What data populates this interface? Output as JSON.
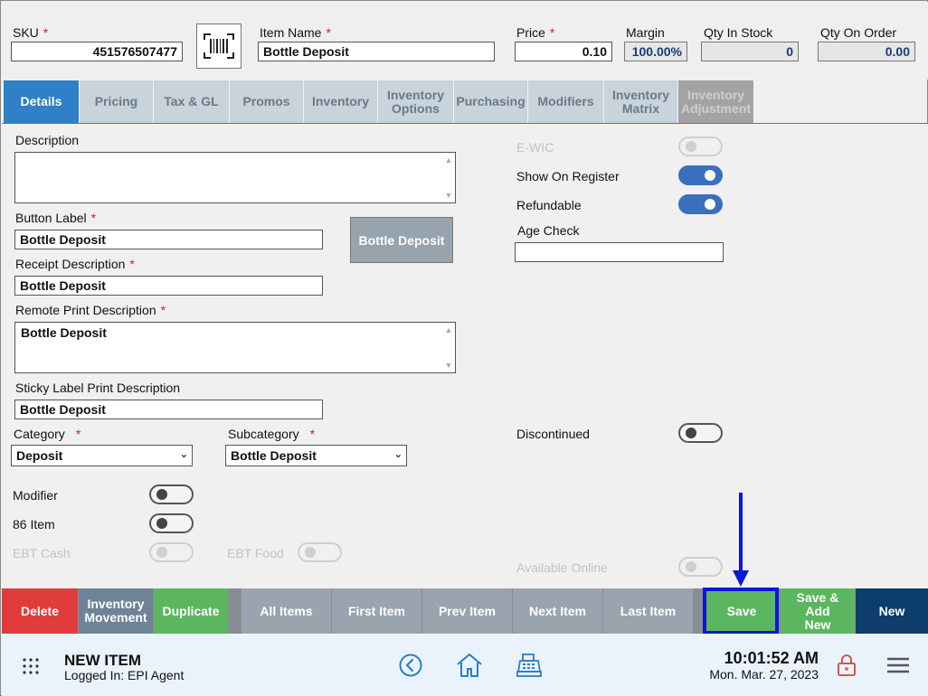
{
  "header": {
    "sku_label": "SKU",
    "sku_value": "451576507477",
    "item_name_label": "Item Name",
    "item_name_value": "Bottle Deposit",
    "price_label": "Price",
    "price_value": "0.10",
    "margin_label": "Margin",
    "margin_value": "100.00%",
    "qty_in_stock_label": "Qty In Stock",
    "qty_in_stock_value": "0",
    "qty_on_order_label": "Qty On Order",
    "qty_on_order_value": "0.00",
    "required_mark": "*"
  },
  "tabs": [
    {
      "label": "Details"
    },
    {
      "label": "Pricing"
    },
    {
      "label": "Tax & GL"
    },
    {
      "label": "Promos"
    },
    {
      "label": "Inventory"
    },
    {
      "label": "Inventory Options"
    },
    {
      "label": "Purchasing"
    },
    {
      "label": "Modifiers"
    },
    {
      "label": "Inventory Matrix"
    },
    {
      "label": "Inventory Adjustment"
    }
  ],
  "details": {
    "description_label": "Description",
    "description_value": "",
    "button_label_label": "Button Label",
    "button_label_value": "Bottle Deposit",
    "button_preview": "Bottle Deposit",
    "receipt_desc_label": "Receipt Description",
    "receipt_desc_value": "Bottle Deposit",
    "remote_print_label": "Remote Print Description",
    "remote_print_value": "Bottle Deposit",
    "sticky_label_label": "Sticky Label Print Description",
    "sticky_label_value": "Bottle Deposit",
    "category_label": "Category",
    "category_value": "Deposit",
    "subcategory_label": "Subcategory",
    "subcategory_value": "Bottle Deposit",
    "modifier_label": "Modifier",
    "item86_label": "86 Item",
    "ebt_cash_label": "EBT Cash",
    "ebt_food_label": "EBT Food",
    "ewic_label": "E-WIC",
    "show_on_register_label": "Show On Register",
    "refundable_label": "Refundable",
    "age_check_label": "Age Check",
    "age_check_value": "",
    "discontinued_label": "Discontinued",
    "available_online_label": "Available Online"
  },
  "toggles": {
    "ewic": false,
    "show_on_register": true,
    "refundable": true,
    "discontinued": false,
    "modifier": false,
    "item86": false,
    "ebt_cash": false,
    "ebt_food": false,
    "available_online": false
  },
  "actions": {
    "delete": "Delete",
    "inventory_movement": "Inventory Movement",
    "duplicate": "Duplicate",
    "all_items": "All Items",
    "first_item": "First Item",
    "prev_item": "Prev Item",
    "next_item": "Next Item",
    "last_item": "Last Item",
    "save": "Save",
    "save_add_new": "Save & Add New",
    "new": "New"
  },
  "footer": {
    "title": "NEW ITEM",
    "logged_in": "Logged In:  EPI Agent",
    "time": "10:01:52 AM",
    "date": "Mon. Mar. 27, 2023"
  },
  "colors": {
    "active_tab": "#2f80c6",
    "delete": "#e03c3c",
    "save": "#5cb65f",
    "new": "#0d3d6b",
    "highlight": "#0a16d8"
  },
  "icons": [
    "barcode-icon",
    "apps-grid-icon",
    "back-circle-icon",
    "home-icon",
    "cash-register-icon",
    "lock-icon",
    "menu-icon"
  ]
}
